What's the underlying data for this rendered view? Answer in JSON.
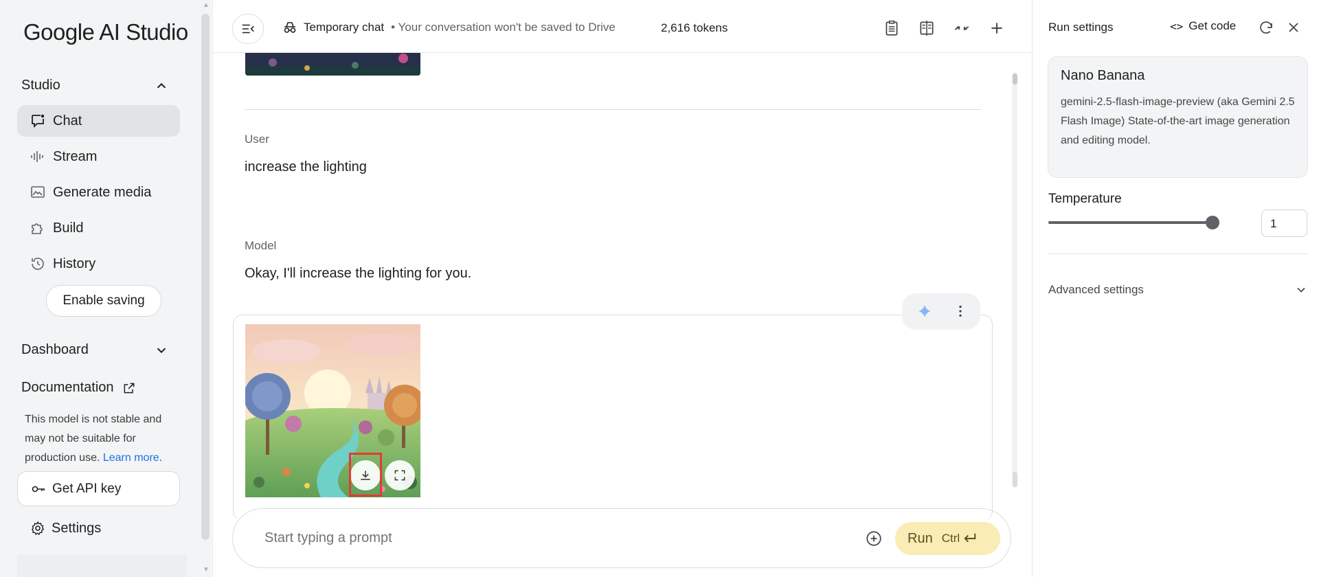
{
  "sidebar": {
    "app_title": "Google AI Studio",
    "studio_label": "Studio",
    "items": [
      {
        "label": "Chat",
        "icon": "chat-icon",
        "active": true
      },
      {
        "label": "Stream",
        "icon": "waveform-icon"
      },
      {
        "label": "Generate media",
        "icon": "image-icon"
      },
      {
        "label": "Build",
        "icon": "puzzle-icon"
      },
      {
        "label": "History",
        "icon": "history-icon"
      }
    ],
    "enable_saving": "Enable saving",
    "dashboard_label": "Dashboard",
    "documentation_label": "Documentation",
    "notice_text": "This model is not stable and may not be suitable for production use.",
    "notice_link": "Learn more",
    "notice_period": ".",
    "api_key_label": "Get API key",
    "settings_label": "Settings"
  },
  "header": {
    "temp_chat": "Temporary chat",
    "temp_sub": "• Your conversation won't be saved to Drive",
    "tokens": "2,616 tokens"
  },
  "chat": {
    "user_role": "User",
    "user_message": "increase the lighting",
    "model_role": "Model",
    "model_message": "Okay, I'll increase the lighting for you."
  },
  "prompt": {
    "placeholder": "Start typing a prompt",
    "run_label": "Run",
    "run_kbd": "Ctrl"
  },
  "run_settings": {
    "title": "Run settings",
    "get_code": "Get code",
    "model_name": "Nano Banana",
    "model_description": "gemini-2.5-flash-image-preview (aka Gemini 2.5 Flash Image) State-of-the-art image generation and editing model.",
    "temperature_label": "Temperature",
    "temperature_value": "1",
    "temperature_fraction": 1.0,
    "advanced_label": "Advanced settings"
  },
  "colors": {
    "run_button": "#f9ecb4",
    "link": "#1a73e8",
    "highlight": "#e53935"
  }
}
